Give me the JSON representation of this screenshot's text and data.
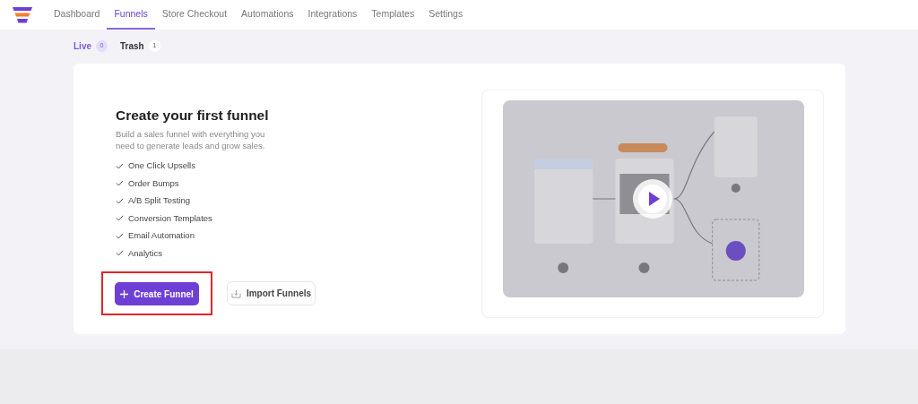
{
  "nav": {
    "items": [
      {
        "label": "Dashboard",
        "selected": false
      },
      {
        "label": "Funnels",
        "selected": true
      },
      {
        "label": "Store Checkout",
        "selected": false
      },
      {
        "label": "Automations",
        "selected": false
      },
      {
        "label": "Integrations",
        "selected": false
      },
      {
        "label": "Templates",
        "selected": false
      },
      {
        "label": "Settings",
        "selected": false
      }
    ]
  },
  "tabs": [
    {
      "label": "Live",
      "count": "0",
      "selected": true
    },
    {
      "label": "Trash",
      "count": "1",
      "selected": false
    }
  ],
  "intro": {
    "title": "Create your first funnel",
    "description": "Build a sales funnel with everything you need to generate leads and grow sales.",
    "features": [
      "One Click Upsells",
      "Order Bumps",
      "A/B Split Testing",
      "Conversion Templates",
      "Email Automation",
      "Analytics"
    ]
  },
  "buttons": [
    {
      "kind": "primary",
      "label": "Create Funnel",
      "highlighted": true
    },
    {
      "kind": "secondary",
      "label": "Import Funnels",
      "highlighted": false
    }
  ]
}
